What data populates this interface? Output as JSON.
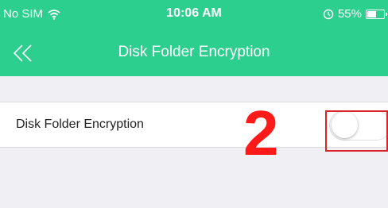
{
  "status_bar": {
    "carrier": "No SIM",
    "time": "10:06 AM",
    "battery_percent": "55%",
    "battery_level": 0.55
  },
  "nav": {
    "title": "Disk Folder Encryption",
    "back_icon": "double-chevron-left-icon"
  },
  "settings": {
    "encryption_label": "Disk Folder Encryption",
    "encryption_enabled": false
  },
  "annotation": {
    "step_number": "2",
    "color": "#ff1a1a"
  },
  "colors": {
    "header": "#2dcf8e",
    "background": "#efeff4",
    "highlight": "#d9252a"
  }
}
